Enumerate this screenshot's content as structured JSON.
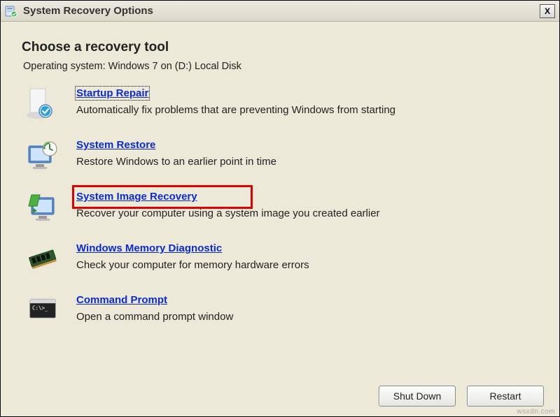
{
  "titlebar": {
    "title": "System Recovery Options",
    "close": "X"
  },
  "main": {
    "heading": "Choose a recovery tool",
    "subheading": "Operating system: Windows 7 on (D:) Local Disk"
  },
  "tools": [
    {
      "title": "Startup Repair",
      "desc": "Automatically fix problems that are preventing Windows from starting",
      "focused": true,
      "highlighted": false
    },
    {
      "title": "System Restore",
      "desc": "Restore Windows to an earlier point in time",
      "focused": false,
      "highlighted": false
    },
    {
      "title": "System Image Recovery",
      "desc": "Recover your computer using a system image you created earlier",
      "focused": false,
      "highlighted": true
    },
    {
      "title": "Windows Memory Diagnostic",
      "desc": "Check your computer for memory hardware errors",
      "focused": false,
      "highlighted": false
    },
    {
      "title": "Command Prompt",
      "desc": "Open a command prompt window",
      "focused": false,
      "highlighted": false
    }
  ],
  "buttons": {
    "shutdown": "Shut Down",
    "restart": "Restart"
  },
  "watermark": "wsxdn.com"
}
